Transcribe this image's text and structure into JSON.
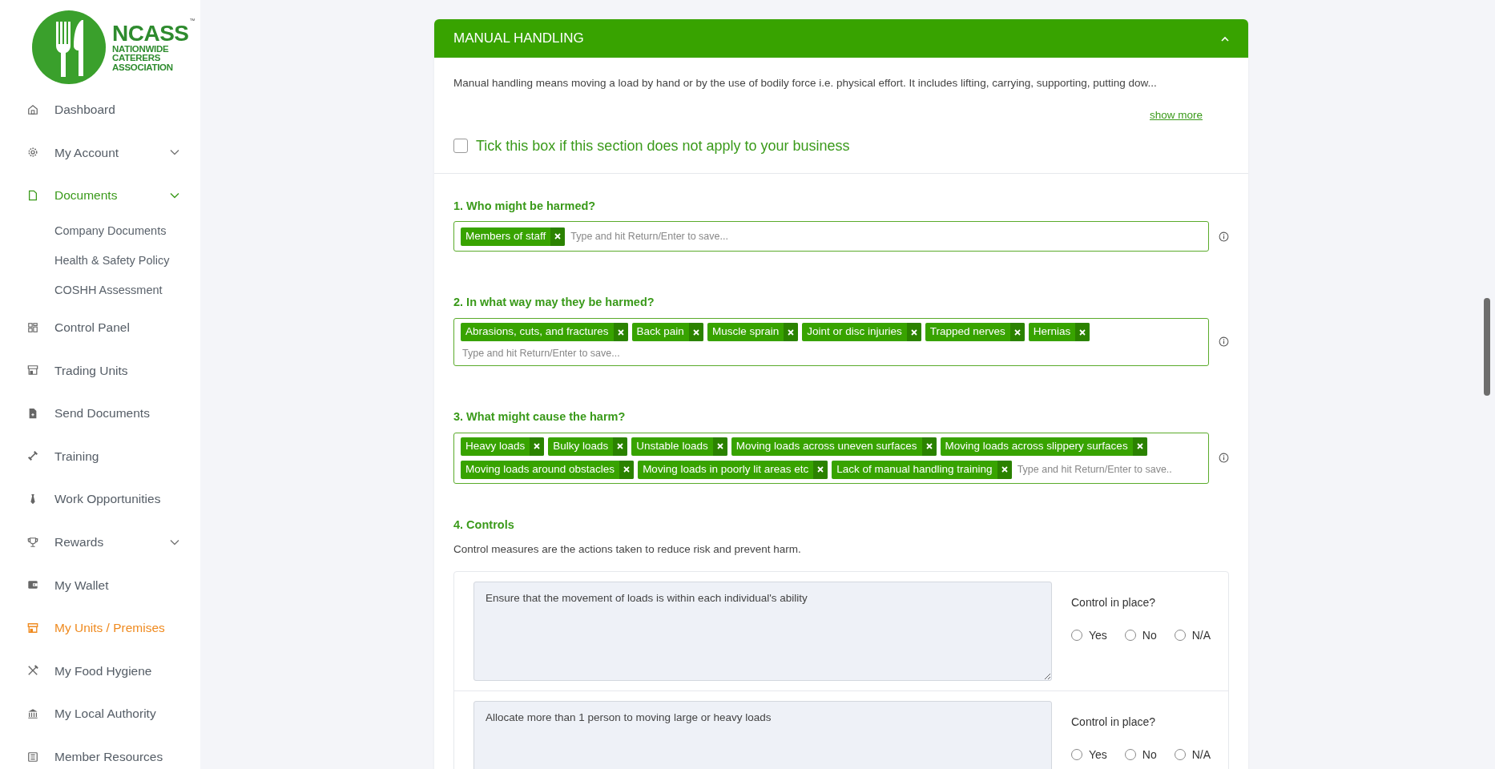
{
  "logo": {
    "name": "NCASS",
    "lines": [
      "NATIONWIDE",
      "CATERERS",
      "ASSOCIATION"
    ],
    "mark": "™"
  },
  "sidebar": {
    "items": [
      {
        "label": "Dashboard",
        "selected": false
      },
      {
        "label": "My Account",
        "selected": false,
        "expanded": false
      },
      {
        "label": "Documents",
        "selected": false,
        "expanded": true,
        "children": [
          {
            "label": "Company Documents"
          },
          {
            "label": "Health & Safety Policy"
          },
          {
            "label": "COSHH Assessment"
          }
        ]
      },
      {
        "label": "Control Panel",
        "selected": false
      },
      {
        "label": "Trading Units",
        "selected": false
      },
      {
        "label": "Send Documents",
        "selected": false
      },
      {
        "label": "Training",
        "selected": false
      },
      {
        "label": "Work Opportunities",
        "selected": false
      },
      {
        "label": "Rewards",
        "selected": false,
        "expanded": false
      },
      {
        "label": "My Wallet",
        "selected": false
      },
      {
        "label": "My Units / Premises",
        "selected": true
      },
      {
        "label": "My Food Hygiene",
        "selected": false
      },
      {
        "label": "My Local Authority",
        "selected": false
      },
      {
        "label": "Member Resources",
        "selected": false
      }
    ]
  },
  "section": {
    "title": "MANUAL HANDLING",
    "expanded": true,
    "description": "Manual handling means moving a load by hand or by the use of bodily force i.e. physical effort. It includes lifting, carrying, supporting, putting dow...",
    "show_more": "show more",
    "not_applicable": {
      "label": "Tick this box if this section does not apply to your business",
      "checked": false
    },
    "questions": [
      {
        "title": "1. Who might be harmed?",
        "tags": [
          "Members of staff"
        ],
        "placeholder": "Type and hit Return/Enter to save..."
      },
      {
        "title": "2. In what way may they be harmed?",
        "tags": [
          "Abrasions, cuts, and fractures",
          "Back pain",
          "Muscle sprain",
          "Joint or disc injuries",
          "Trapped nerves",
          "Hernias"
        ],
        "placeholder": "Type and hit Return/Enter to save..."
      },
      {
        "title": "3. What might cause the harm?",
        "tags": [
          "Heavy loads",
          "Bulky loads",
          "Unstable loads",
          "Moving loads across uneven surfaces",
          "Moving loads across slippery surfaces",
          "Moving loads around obstacles",
          "Moving loads in poorly lit areas etc",
          "Lack of manual handling training"
        ],
        "placeholder": "Type and hit Return/Enter to save.."
      }
    ],
    "controls": {
      "title": "4. Controls",
      "description": "Control measures are the actions taken to reduce risk and prevent harm.",
      "items": [
        {
          "text": "Ensure that the movement of loads is within each individual's ability",
          "question": "Control in place?",
          "options": [
            {
              "label": "Yes",
              "selected": false
            },
            {
              "label": "No",
              "selected": false
            },
            {
              "label": "N/A",
              "selected": false
            }
          ]
        },
        {
          "text": "Allocate more than 1 person to moving large or heavy loads",
          "question": "Control in place?",
          "options": [
            {
              "label": "Yes",
              "selected": false
            },
            {
              "label": "No",
              "selected": false
            },
            {
              "label": "N/A",
              "selected": false
            }
          ]
        }
      ]
    }
  }
}
